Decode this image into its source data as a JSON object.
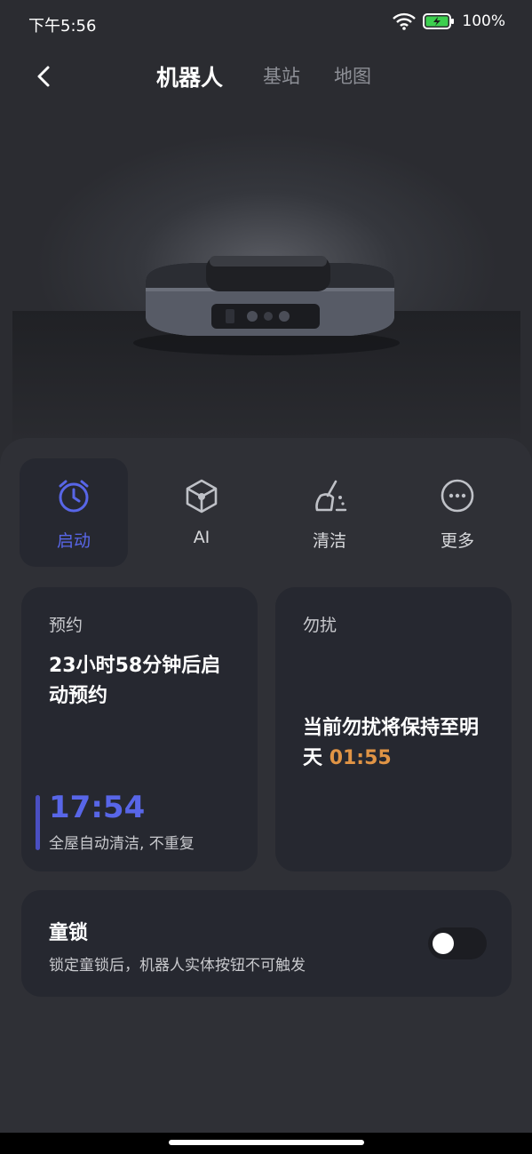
{
  "status_bar": {
    "time": "下午5:56",
    "battery": "100%"
  },
  "nav": {
    "tabs": [
      {
        "label": "机器人"
      },
      {
        "label": "基站"
      },
      {
        "label": "地图"
      }
    ]
  },
  "quick_actions": [
    {
      "label": "启动",
      "icon": "alarm-clock-icon"
    },
    {
      "label": "AI",
      "icon": "cube-icon"
    },
    {
      "label": "清洁",
      "icon": "broom-icon"
    },
    {
      "label": "更多",
      "icon": "more-dots-icon"
    }
  ],
  "schedule_card": {
    "title": "预约",
    "text": "23小时58分钟后启动预约",
    "time": "17:54",
    "subtitle": "全屋自动清洁, 不重复"
  },
  "dnd_card": {
    "title": "勿扰",
    "text": "当前勿扰将保持至明天",
    "time": "01:55"
  },
  "child_lock": {
    "title": "童锁",
    "subtitle": "锁定童锁后，机器人实体按钮不可触发",
    "enabled": false
  },
  "colors": {
    "accent_blue": "#5866e8",
    "accent_orange": "#e09445",
    "card_bg": "#262830"
  }
}
